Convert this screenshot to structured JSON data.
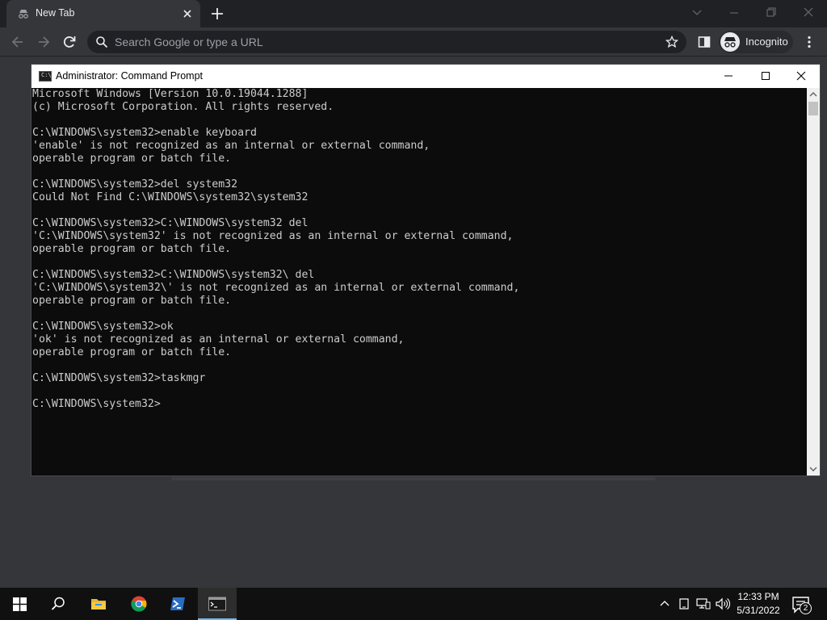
{
  "browser": {
    "tab_title": "New Tab",
    "omnibox_placeholder": "Search Google or type a URL",
    "profile_label": "Incognito"
  },
  "cmd": {
    "window_title": "Administrator: Command Prompt",
    "icon_text": "C:\\_",
    "lines": [
      "Microsoft Windows [Version 10.0.19044.1288]",
      "(c) Microsoft Corporation. All rights reserved.",
      "",
      "C:\\WINDOWS\\system32>enable keyboard",
      "'enable' is not recognized as an internal or external command,",
      "operable program or batch file.",
      "",
      "C:\\WINDOWS\\system32>del system32",
      "Could Not Find C:\\WINDOWS\\system32\\system32",
      "",
      "C:\\WINDOWS\\system32>C:\\WINDOWS\\system32 del",
      "'C:\\WINDOWS\\system32' is not recognized as an internal or external command,",
      "operable program or batch file.",
      "",
      "C:\\WINDOWS\\system32>C:\\WINDOWS\\system32\\ del",
      "'C:\\WINDOWS\\system32\\' is not recognized as an internal or external command,",
      "operable program or batch file.",
      "",
      "C:\\WINDOWS\\system32>ok",
      "'ok' is not recognized as an internal or external command,",
      "operable program or batch file.",
      "",
      "C:\\WINDOWS\\system32>taskmgr",
      "",
      "C:\\WINDOWS\\system32>"
    ]
  },
  "taskbar": {
    "time": "12:33 PM",
    "date": "5/31/2022",
    "notification_count": "2",
    "pinned": [
      "start-icon",
      "search-icon",
      "file-explorer-icon",
      "chrome-icon",
      "powershell-icon",
      "command-prompt-icon"
    ]
  },
  "colors": {
    "browser_frame": "#202124",
    "browser_toolbar": "#35363a",
    "console_bg": "#0c0c0c",
    "console_text": "#cccccc",
    "taskbar": "#101010",
    "accent": "#76b9ed"
  }
}
